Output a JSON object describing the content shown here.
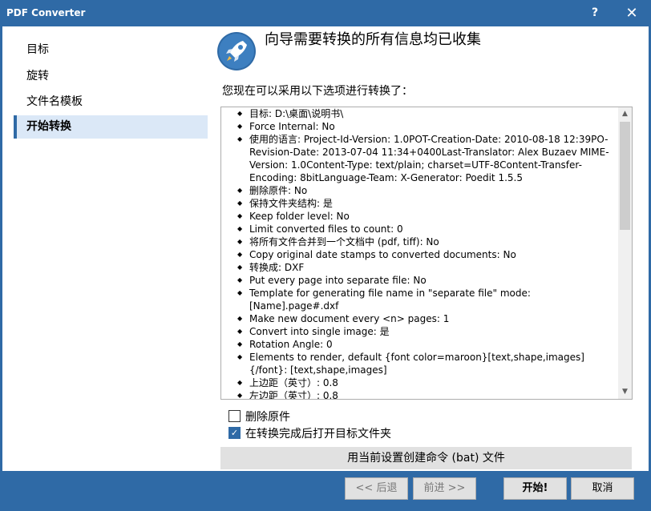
{
  "window": {
    "title": "PDF Converter",
    "help_icon": "?",
    "close_icon": "✕"
  },
  "sidebar": {
    "items": [
      {
        "label": "目标",
        "active": false
      },
      {
        "label": "旋转",
        "active": false
      },
      {
        "label": "文件名模板",
        "active": false
      },
      {
        "label": "开始转换",
        "active": true
      }
    ]
  },
  "main": {
    "heading": "向导需要转换的所有信息均已收集",
    "subtitle": "您现在可以采用以下选项进行转换了：",
    "summary": [
      "目标: D:\\桌面\\说明书\\",
      "Force Internal: No",
      "使用的语言: Project-Id-Version: 1.0POT-Creation-Date: 2010-08-18 12:39PO-Revision-Date: 2013-07-04 11:34+0400Last-Translator: Alex Buzaev MIME-Version: 1.0Content-Type: text/plain; charset=UTF-8Content-Transfer-Encoding: 8bitLanguage-Team: X-Generator: Poedit 1.5.5",
      "删除原件: No",
      "保持文件夹结构: 是",
      "Keep folder level: No",
      "Limit converted files to count: 0",
      "将所有文件合并到一个文档中 (pdf, tiff): No",
      "Copy original date stamps to converted documents: No",
      "转换成: DXF",
      "Put every page into separate file: No",
      "Template for generating file name in \"separate file\" mode: [Name].page#.dxf",
      "Make new document every <n> pages: 1",
      "Convert into single image: 是",
      "Rotation Angle: 0",
      "Elements to render, default {font color=maroon}[text,shape,images]{/font}: [text,shape,images]",
      "上边距（英寸）: 0.8",
      "左边距（英寸）: 0.8"
    ],
    "delete_originals_label": "删除原件",
    "delete_originals_checked": false,
    "open_folder_label": "在转换完成后打开目标文件夹",
    "open_folder_checked": true,
    "create_bat_label": "用当前设置创建命令 (bat) 文件"
  },
  "footer": {
    "back_label": "<< 后退",
    "next_label": "前进 >>",
    "start_label": "开始!",
    "cancel_label": "取消"
  },
  "colors": {
    "accent": "#2f6aa6",
    "active_item_bg": "#dbe8f7",
    "button_face": "#e1e1e1"
  }
}
